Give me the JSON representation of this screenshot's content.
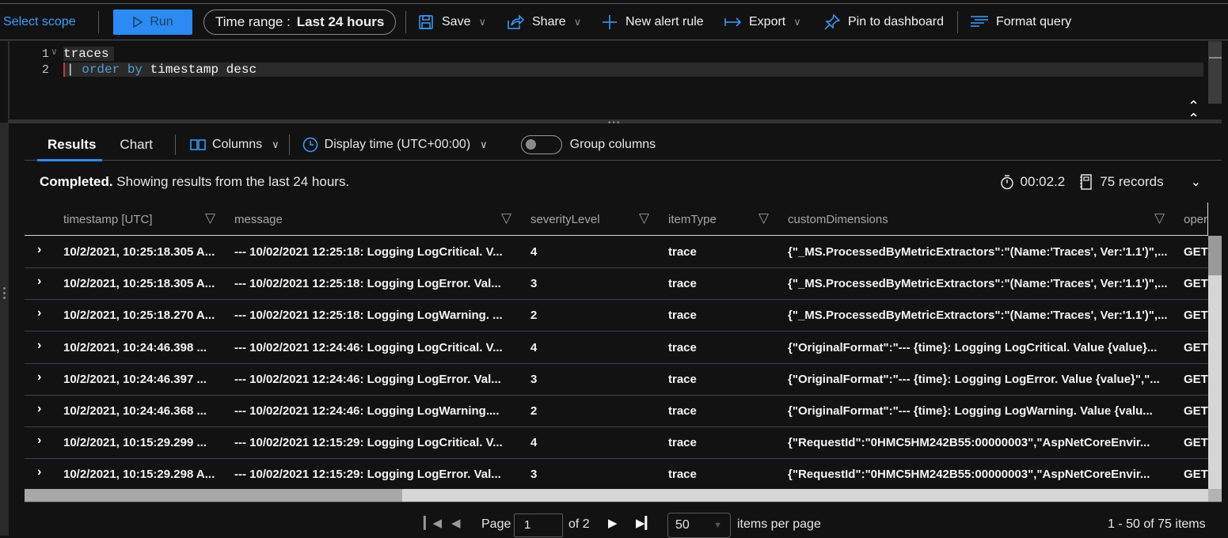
{
  "toolbar": {
    "scope_label": "Select scope",
    "run_label": "Run",
    "time_range_prefix": "Time range :",
    "time_range_value": "Last 24 hours",
    "save_label": "Save",
    "share_label": "Share",
    "new_alert_label": "New alert rule",
    "export_label": "Export",
    "pin_label": "Pin to dashboard",
    "format_label": "Format query"
  },
  "editor": {
    "lines": [
      {
        "number": "1",
        "text": "traces"
      },
      {
        "number": "2",
        "pipe": "|",
        "keyword": "order by",
        "rest": "timestamp desc"
      }
    ]
  },
  "results_bar": {
    "tabs": [
      {
        "label": "Results",
        "active": true
      },
      {
        "label": "Chart",
        "active": false
      }
    ],
    "columns_label": "Columns",
    "display_time_label": "Display time (UTC+00:00)",
    "group_columns_label": "Group columns",
    "group_columns_on": false
  },
  "status": {
    "completed": "Completed.",
    "message": "Showing results from the last 24 hours.",
    "duration": "00:02.2",
    "records": "75 records"
  },
  "grid": {
    "columns": [
      "timestamp [UTC]",
      "message",
      "severityLevel",
      "itemType",
      "customDimensions",
      "oper"
    ],
    "rows": [
      [
        "10/2/2021, 10:25:18.305 A...",
        "--- 10/02/2021 12:25:18: Logging LogCritical. V...",
        "4",
        "trace",
        "{\"_MS.ProcessedByMetricExtractors\":\"(Name:'Traces', Ver:'1.1')\",...",
        "GET"
      ],
      [
        "10/2/2021, 10:25:18.305 A...",
        "--- 10/02/2021 12:25:18: Logging LogError. Val...",
        "3",
        "trace",
        "{\"_MS.ProcessedByMetricExtractors\":\"(Name:'Traces', Ver:'1.1')\",...",
        "GET"
      ],
      [
        "10/2/2021, 10:25:18.270 A...",
        "--- 10/02/2021 12:25:18: Logging LogWarning. ...",
        "2",
        "trace",
        "{\"_MS.ProcessedByMetricExtractors\":\"(Name:'Traces', Ver:'1.1')\",...",
        "GET"
      ],
      [
        "10/2/2021, 10:24:46.398 ...",
        "--- 10/02/2021 12:24:46: Logging LogCritical. V...",
        "4",
        "trace",
        "{\"OriginalFormat\":\"--- {time}: Logging LogCritical. Value {value}...",
        "GET"
      ],
      [
        "10/2/2021, 10:24:46.397 ...",
        "--- 10/02/2021 12:24:46: Logging LogError. Val...",
        "3",
        "trace",
        "{\"OriginalFormat\":\"--- {time}: Logging LogError. Value {value}\",\"...",
        "GET"
      ],
      [
        "10/2/2021, 10:24:46.368 ...",
        "--- 10/02/2021 12:24:46: Logging LogWarning....",
        "2",
        "trace",
        "{\"OriginalFormat\":\"--- {time}: Logging LogWarning. Value {valu...",
        "GET"
      ],
      [
        "10/2/2021, 10:15:29.299 ...",
        "--- 10/02/2021 12:15:29: Logging LogCritical. V...",
        "4",
        "trace",
        "{\"RequestId\":\"0HMC5HM242B55:00000003\",\"AspNetCoreEnvir...",
        "GET"
      ],
      [
        "10/2/2021, 10:15:29.298 A...",
        "--- 10/02/2021 12:15:29: Logging LogError. Val...",
        "3",
        "trace",
        "{\"RequestId\":\"0HMC5HM242B55:00000003\",\"AspNetCoreEnvir...",
        "GET"
      ]
    ]
  },
  "pager": {
    "page_label": "Page",
    "current_page": "1",
    "of_label": "of 2",
    "page_size": "50",
    "items_per_page_label": "items per page",
    "range_label": "1 - 50 of 75 items"
  }
}
